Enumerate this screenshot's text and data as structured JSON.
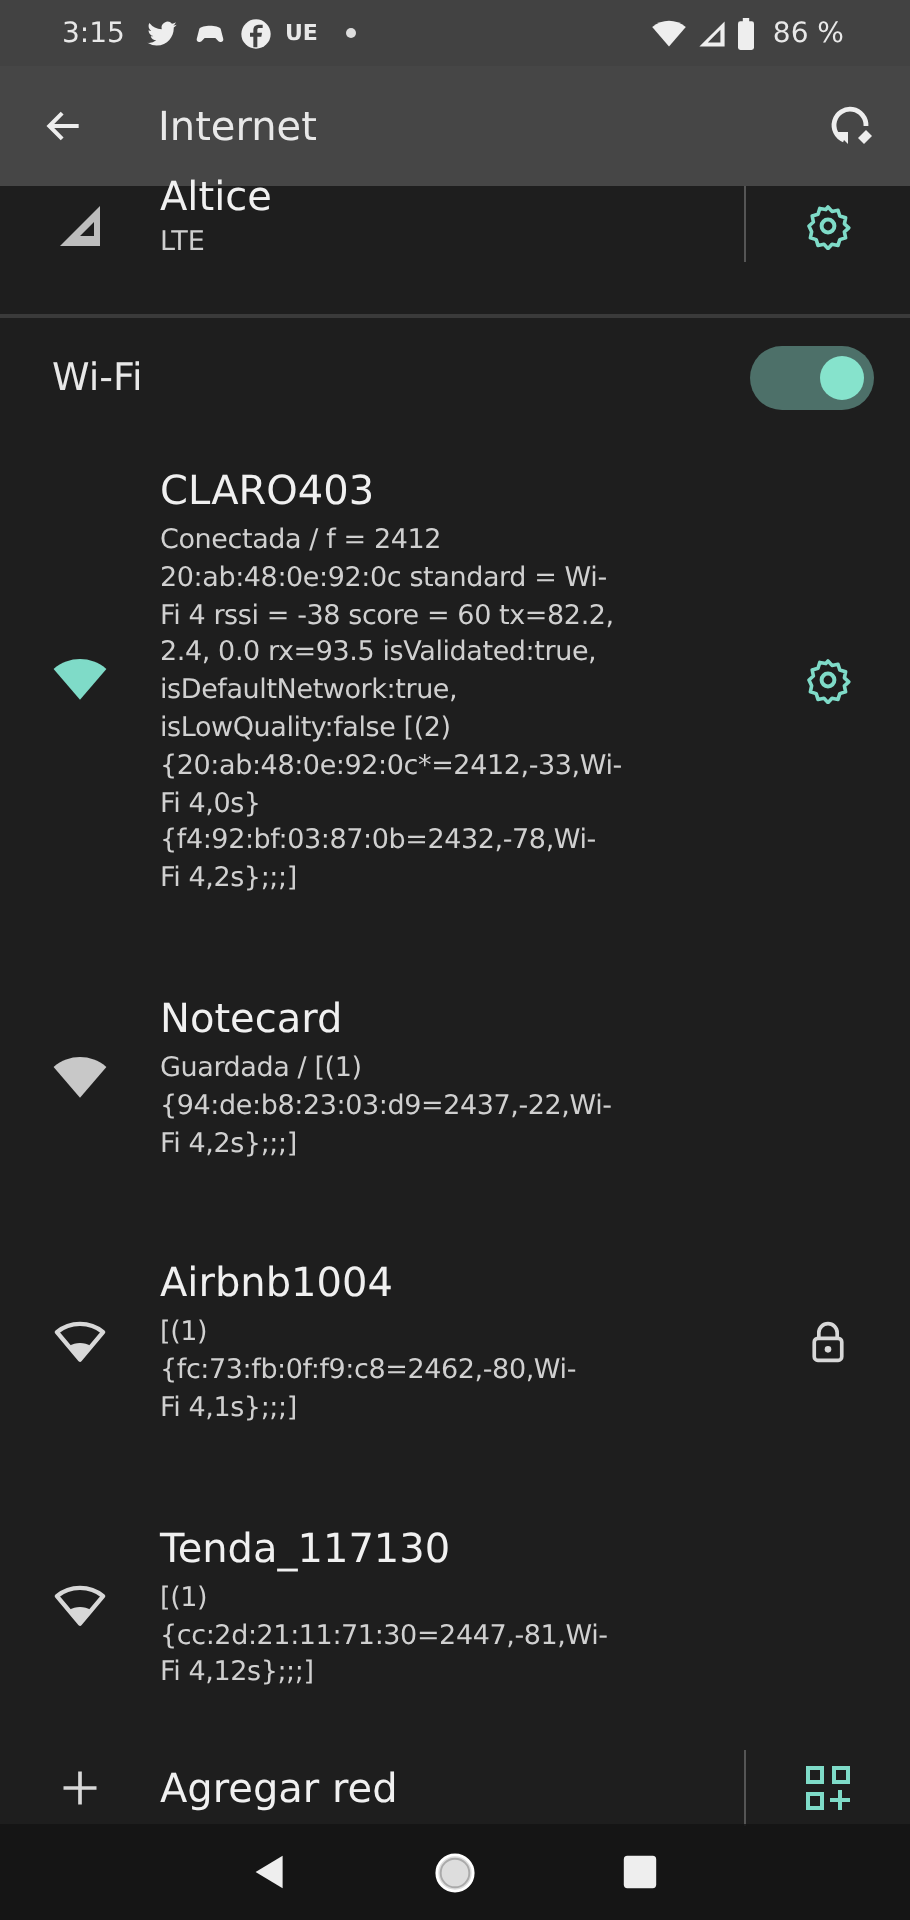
{
  "status_bar": {
    "time": "3:15",
    "notification_text": "UE",
    "battery": "86 %"
  },
  "toolbar": {
    "title": "Internet"
  },
  "mobile": {
    "name": "Altice",
    "subtitle": "LTE"
  },
  "wifi_toggle": {
    "label": "Wi-Fi",
    "on": true
  },
  "networks": [
    {
      "name": "CLARO403",
      "details": "Conectada / f = 2412\n20:ab:48:0e:92:0c standard = Wi-\nFi 4 rssi = -38 score = 60  tx=82.2,\n2.4, 0.0  rx=93.5 isValidated:true,\nisDefaultNetwork:true,\nisLowQuality:false [(2)\n{20:ab:48:0e:92:0c*=2412,-33,Wi-\nFi 4,0s}\n{f4:92:bf:03:87:0b=2432,-78,Wi-\nFi 4,2s};;;]",
      "connected": true,
      "kind": "full",
      "settings_button": true,
      "locked": false
    },
    {
      "name": "Notecard",
      "details": "Guardada / [(1)\n{94:de:b8:23:03:d9=2437,-22,Wi-\nFi 4,2s};;;]",
      "connected": false,
      "kind": "full",
      "settings_button": false,
      "locked": false
    },
    {
      "name": "Airbnb1004",
      "details": "[(1)\n{fc:73:fb:0f:f9:c8=2462,-80,Wi-\nFi 4,1s};;;]",
      "connected": false,
      "kind": "weak",
      "settings_button": false,
      "locked": true
    },
    {
      "name": "Tenda_117130",
      "details": "[(1)\n{cc:2d:21:11:71:30=2447,-81,Wi-\nFi 4,12s};;;]",
      "connected": false,
      "kind": "weak",
      "settings_button": false,
      "locked": false
    }
  ],
  "add_network": {
    "label": "Agregar red"
  }
}
